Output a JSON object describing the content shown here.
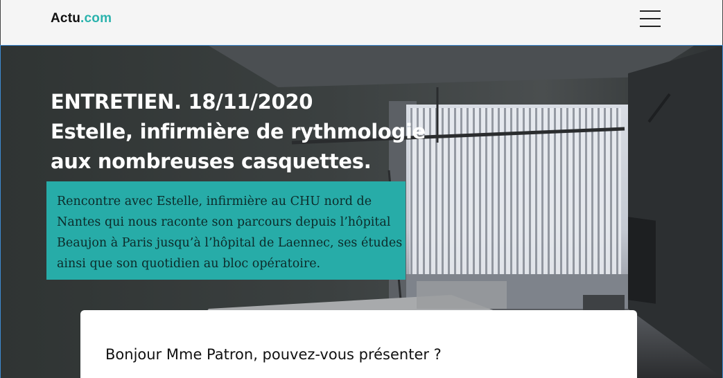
{
  "header": {
    "logo_text": "Actu",
    "logo_suffix": ".com",
    "menu_icon": "hamburger-menu-icon"
  },
  "colors": {
    "accent": "#2bb3ad",
    "intro_bg": "#27aca8",
    "hero_dark": "#313534"
  },
  "hero": {
    "title_line1": "ENTRETIEN. 18/11/2020",
    "title_line2": "Estelle, infirmière de rythmologie",
    "title_line3": "aux nombreuses casquettes.",
    "intro_lines": [
      "Rencontre avec Estelle, infirmière au CHU nord de",
      "Nantes qui nous raconte son parcours depuis l’hôpital",
      "Beaujon à Paris jusqu’à l’hôpital de Laennec, ses études",
      "ainsi que son quotidien au bloc opératoire."
    ]
  },
  "article": {
    "first_question": "Bonjour Mme Patron, pouvez-vous présenter ?"
  }
}
